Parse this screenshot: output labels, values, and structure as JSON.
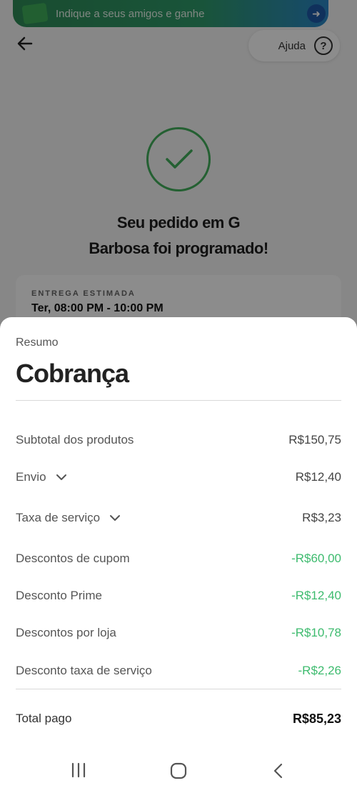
{
  "notification": {
    "text": "Indique a seus amigos e ganhe"
  },
  "header": {
    "help_label": "Ajuda",
    "help_icon": "question-circle-icon",
    "back_icon": "arrow-left-icon"
  },
  "order": {
    "title_line1": "Seu pedido em G",
    "title_line2": "Barbosa foi programado!",
    "delivery_label": "ENTREGA ESTIMADA",
    "delivery_value": "Ter, 08:00 PM - 10:00 PM"
  },
  "sheet": {
    "subtitle": "Resumo",
    "title": "Cobrança",
    "rows": [
      {
        "label": "Subtotal dos produtos",
        "value": "R$150,75"
      },
      {
        "label": "Envio",
        "value": "R$12,40"
      },
      {
        "label": "Taxa de serviço",
        "value": "R$3,23"
      },
      {
        "label": "Descontos de cupom",
        "value": "-R$60,00"
      },
      {
        "label": "Desconto Prime",
        "value": "-R$12,40"
      },
      {
        "label": "Descontos por loja",
        "value": "-R$10,78"
      },
      {
        "label": "Desconto taxa de serviço",
        "value": "-R$2,26"
      }
    ],
    "total": {
      "label": "Total pago",
      "value": "R$85,23"
    }
  },
  "colors": {
    "accent_green": "#3dbb6e",
    "check_green": "#43b05c"
  }
}
